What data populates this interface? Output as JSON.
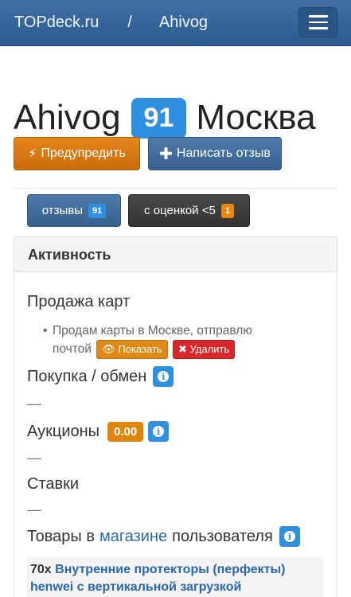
{
  "navbar": {
    "site": "TOPdeck.ru",
    "separator": "/",
    "user": "Ahivog"
  },
  "profile": {
    "name": "Ahivog",
    "score": "91",
    "city": "Москва"
  },
  "actions": {
    "warn_label": "Предупредить",
    "write_review_label": "Написать отзыв"
  },
  "tabs": {
    "reviews_label": "отзывы",
    "reviews_count": "91",
    "low_rating_label": "с оценкой <5",
    "low_rating_count": "1"
  },
  "panel": {
    "title": "Активность",
    "sale": {
      "heading": "Продажа карт",
      "listing_text": "Продам карты в Москве, отправлю почтой",
      "show_label": "Показать",
      "delete_label": "Удалить"
    },
    "purchase": {
      "heading": "Покупка / обмен",
      "empty": "—"
    },
    "auctions": {
      "heading": "Аукционы",
      "value": "0.00",
      "empty": "—"
    },
    "bids": {
      "heading": "Ставки",
      "empty": "—"
    },
    "shop": {
      "heading_prefix": "Товары в",
      "link": "магазине",
      "heading_suffix": "пользователя"
    },
    "product": {
      "qty": "70x",
      "name": "Внутренние протекторы (перфекты) henwei с вертикальной загрузкой"
    }
  },
  "colors": {
    "navbar": "#2f5f93",
    "score_badge": "#2f8fe0",
    "warn": "#dd7a14",
    "link": "#2b69a8",
    "delete": "#d9262a"
  }
}
